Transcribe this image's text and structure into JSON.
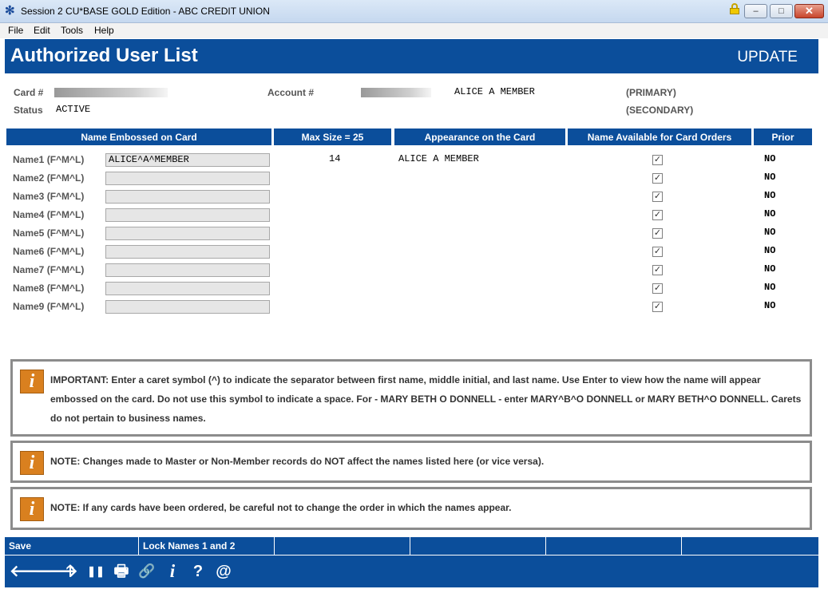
{
  "window": {
    "title": "Session 2 CU*BASE GOLD Edition - ABC CREDIT UNION",
    "min_glyph": "–",
    "max_glyph": "□",
    "close_glyph": "✕"
  },
  "menu": [
    "File",
    "Edit",
    "Tools",
    "Help"
  ],
  "header": {
    "title": "Authorized User List",
    "mode": "UPDATE"
  },
  "info": {
    "card_label": "Card #",
    "account_label": "Account #",
    "member_name": "ALICE A MEMBER",
    "primary": "(PRIMARY)",
    "secondary": "(SECONDARY)",
    "status_label": "Status",
    "status_value": "ACTIVE"
  },
  "table": {
    "columns": [
      "Name Embossed on Card",
      "Max Size = 25",
      "Appearance on the Card",
      "Name Available for Card Orders",
      "Prior"
    ],
    "rows": [
      {
        "label": "Name1 (F^M^L)",
        "value": "ALICE^A^MEMBER",
        "size": "14",
        "appearance": "ALICE A MEMBER",
        "available": "✓",
        "prior": "NO"
      },
      {
        "label": "Name2 (F^M^L)",
        "value": "",
        "size": "",
        "appearance": "",
        "available": "✓",
        "prior": "NO"
      },
      {
        "label": "Name3 (F^M^L)",
        "value": "",
        "size": "",
        "appearance": "",
        "available": "✓",
        "prior": "NO"
      },
      {
        "label": "Name4 (F^M^L)",
        "value": "",
        "size": "",
        "appearance": "",
        "available": "✓",
        "prior": "NO"
      },
      {
        "label": "Name5 (F^M^L)",
        "value": "",
        "size": "",
        "appearance": "",
        "available": "✓",
        "prior": "NO"
      },
      {
        "label": "Name6 (F^M^L)",
        "value": "",
        "size": "",
        "appearance": "",
        "available": "✓",
        "prior": "NO"
      },
      {
        "label": "Name7 (F^M^L)",
        "value": "",
        "size": "",
        "appearance": "",
        "available": "✓",
        "prior": "NO"
      },
      {
        "label": "Name8 (F^M^L)",
        "value": "",
        "size": "",
        "appearance": "",
        "available": "✓",
        "prior": "NO"
      },
      {
        "label": "Name9 (F^M^L)",
        "value": "",
        "size": "",
        "appearance": "",
        "available": "✓",
        "prior": "NO"
      }
    ]
  },
  "notes": [
    {
      "icon": "i",
      "text": "IMPORTANT:  Enter a caret symbol (^) to indicate the separator between first name, middle initial, and last name. Use Enter to view how the name will appear embossed on the card. Do not use this symbol to indicate a space. For - MARY BETH O DONNELL - enter MARY^B^O DONNELL or MARY BETH^O DONNELL. Carets do not pertain to business names."
    },
    {
      "icon": "i",
      "text": "NOTE: Changes made to Master or Non-Member records do NOT affect the names listed here (or vice versa)."
    },
    {
      "icon": "i",
      "text": "NOTE: If any cards have been ordered, be careful not to change the order in which the names appear."
    }
  ],
  "fkeys": [
    "Save",
    "Lock Names 1 and 2",
    "",
    "",
    "",
    "",
    ""
  ],
  "toolbar": {
    "back": "🡐",
    "forward": "🡒",
    "up": "🡑",
    "pause": "❚❚",
    "print": "🖶",
    "link": "🔗",
    "info": "i",
    "help": "?",
    "email": "@"
  },
  "colors": {
    "brand_blue": "#0b4e9b",
    "info_orange": "#d9801f"
  }
}
